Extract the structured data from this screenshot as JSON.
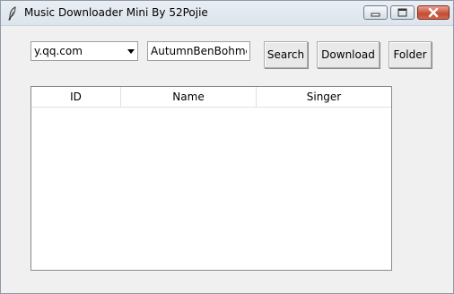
{
  "window": {
    "title": "Music Downloader Mini By 52Pojie",
    "icon": "feather-icon"
  },
  "toolbar": {
    "source_selected": "y.qq.com",
    "search_value": "AutumnBenBohmer",
    "search_label": "Search",
    "download_label": "Download",
    "folder_label": "Folder"
  },
  "table": {
    "columns": [
      "ID",
      "Name",
      "Singer"
    ],
    "rows": []
  },
  "colors": {
    "window_bg": "#f0f0f0",
    "close_button": "#c44a32"
  }
}
